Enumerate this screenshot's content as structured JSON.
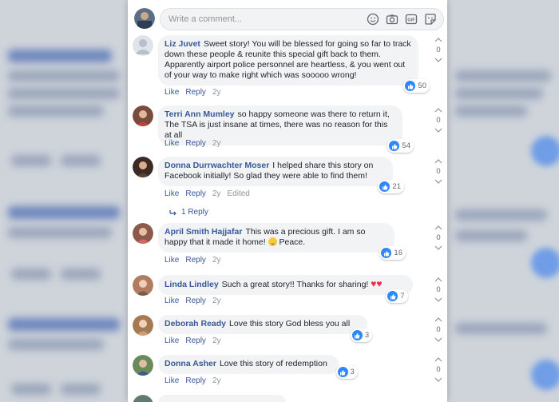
{
  "compose": {
    "placeholder": "Write a comment...",
    "icons": [
      "emoji-icon",
      "camera-icon",
      "gif-icon",
      "sticker-icon"
    ]
  },
  "colors": {
    "author": "#385898",
    "bubble": "#f2f3f5",
    "like_blue": "#2d88ff",
    "muted": "#90949c"
  },
  "comments": [
    {
      "author": "Liz Juvet",
      "text": "Sweet story! You will be blessed for going so far to track down these people & reunite this special gift back to them. Apparently airport police personnel are heartless, & you went out of your way to make right which was sooooo wrong!",
      "likes": "50",
      "like": "Like",
      "reply": "Reply",
      "time": "2y",
      "votes": "0"
    },
    {
      "author": "Terri Ann Mumley",
      "text": "so happy someone was there to return it, The TSA is just insane at times, there was no reason for this at all",
      "likes": "54",
      "like": "Like",
      "reply": "Reply",
      "time": "2y",
      "votes": "0"
    },
    {
      "author": "Donna Durrwachter Moser",
      "text": "I helped share this story on Facebook initially! So glad they were able to find them!",
      "likes": "21",
      "like": "Like",
      "reply": "Reply",
      "time": "2y",
      "edited": "Edited",
      "votes": "0",
      "replies_link": "1 Reply"
    },
    {
      "author": "April Smith Hajjafar",
      "text": "This was a precious gift. I am so happy that it made it home!",
      "text_after_emoji": "Peace.",
      "likes": "16",
      "like": "Like",
      "reply": "Reply",
      "time": "2y",
      "votes": "0"
    },
    {
      "author": "Linda Lindley",
      "text": "Such a great story!! Thanks for sharing!",
      "likes": "7",
      "like": "Like",
      "reply": "Reply",
      "time": "2y",
      "votes": "0"
    },
    {
      "author": "Deborah Ready",
      "text": "Love this story God bless you all",
      "likes": "3",
      "like": "Like",
      "reply": "Reply",
      "time": "2y",
      "votes": "0"
    },
    {
      "author": "Donna Asher",
      "text": "Love this story of redemption",
      "likes": "3",
      "like": "Like",
      "reply": "Reply",
      "time": "2y",
      "votes": "0"
    }
  ]
}
